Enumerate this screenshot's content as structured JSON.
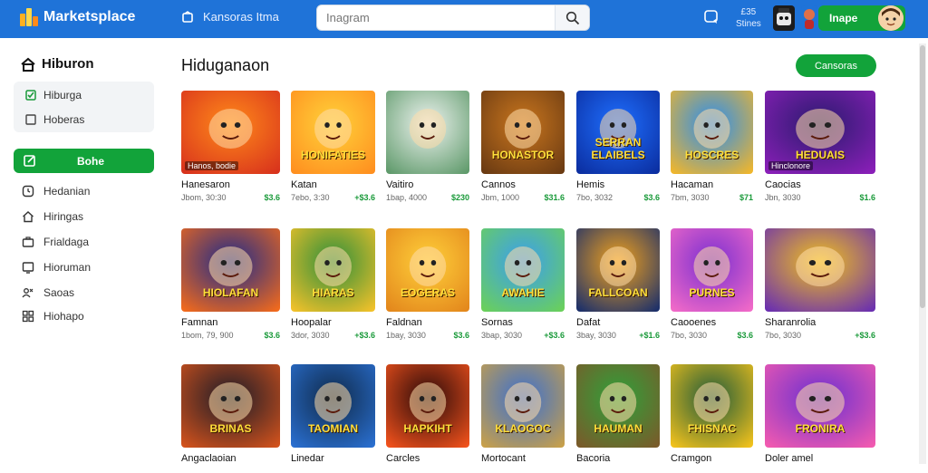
{
  "header": {
    "logo_text": "Marketsplace",
    "nav_label": "Kansoras Itma",
    "search_placeholder": "Inagram",
    "stats_line1": "£35",
    "stats_line2": "Stines",
    "cta_label": "Inape"
  },
  "sidebar": {
    "title": "Hiburon",
    "card_items": [
      {
        "label": "Hiburga",
        "icon": "checkbox-checked-icon"
      },
      {
        "label": "Hoberas",
        "icon": "checkbox-empty-icon"
      }
    ],
    "active_item": {
      "label": "Bohe",
      "icon": "edit-icon"
    },
    "items": [
      {
        "label": "Hedanian",
        "icon": "clock-icon"
      },
      {
        "label": "Hiringas",
        "icon": "home-icon"
      },
      {
        "label": "Frialdaga",
        "icon": "briefcase-icon"
      },
      {
        "label": "Hioruman",
        "icon": "monitor-icon"
      },
      {
        "label": "Saoas",
        "icon": "people-icon"
      },
      {
        "label": "Hiohapo",
        "icon": "grid-icon"
      }
    ]
  },
  "main": {
    "title": "Hiduganaon",
    "cta_label": "Cansoras",
    "rows": [
      [
        {
          "title": "Hanesaron",
          "meta": "Jbom, 30:30",
          "price": "$3.6",
          "art": "",
          "tag": "Hanos, bodie",
          "colors": [
            "#ff8a1a",
            "#d8321c"
          ]
        },
        {
          "title": "Katan",
          "meta": "7ebo, 3:30",
          "price": "+$3.6",
          "art": "HONIFATIES",
          "tag": "",
          "colors": [
            "#ffd23a",
            "#ff8f1f"
          ]
        },
        {
          "title": "Vaitiro",
          "meta": "1bap, 4000",
          "price": "$230",
          "art": "",
          "tag": "",
          "colors": [
            "#eef3f0",
            "#5f9a6b"
          ]
        },
        {
          "title": "Cannos",
          "meta": "Jbm, 1000",
          "price": "$31.6",
          "art": "HONASTOR",
          "tag": "",
          "colors": [
            "#c9761e",
            "#6a3a12"
          ]
        },
        {
          "title": "Hemis",
          "meta": "7bo, 3032",
          "price": "$3.6",
          "art": "SERRAN ELAIBELS",
          "tag": "",
          "colors": [
            "#1f6fff",
            "#0b2ea0"
          ]
        },
        {
          "title": "Hacaman",
          "meta": "7bm, 3030",
          "price": "$71",
          "art": "HOSCRES",
          "tag": "",
          "colors": [
            "#2a8df0",
            "#f0b62c"
          ]
        },
        {
          "title": "Caocias",
          "meta": "Jbn, 3030",
          "price": "$1.6",
          "art": "HEDUAIS",
          "tag": "Hinclonore",
          "colors": [
            "#2a1b6e",
            "#8a1fb8"
          ]
        }
      ],
      [
        {
          "title": "Famnan",
          "meta": "1bom, 79, 900",
          "price": "$3.6",
          "art": "HIOLAFAN",
          "tag": "",
          "colors": [
            "#1d2a8a",
            "#f26a1c"
          ]
        },
        {
          "title": "Hoopalar",
          "meta": "3dor, 3030",
          "price": "+$3.6",
          "art": "HIARAS",
          "tag": "",
          "colors": [
            "#2e8f3a",
            "#f2c12a"
          ]
        },
        {
          "title": "Faldnan",
          "meta": "1bay, 3030",
          "price": "$3.6",
          "art": "EOGERAS",
          "tag": "",
          "colors": [
            "#ffd03a",
            "#e3871c"
          ]
        },
        {
          "title": "Sornas",
          "meta": "3bap, 3030",
          "price": "+$3.6",
          "art": "AWAHIE",
          "tag": "",
          "colors": [
            "#3b9ef0",
            "#6ad05a"
          ]
        },
        {
          "title": "Dafat",
          "meta": "3bay, 3030",
          "price": "+$1.6",
          "art": "FALLCOAN",
          "tag": "",
          "colors": [
            "#f2a21c",
            "#1b2f6a"
          ]
        },
        {
          "title": "Caooenes",
          "meta": "7bo, 3030",
          "price": "$3.6",
          "art": "PURNES",
          "tag": "",
          "colors": [
            "#7a2fd0",
            "#f26ac8"
          ]
        },
        {
          "title": "Sharanrolia",
          "meta": "7bo, 3030",
          "price": "+$3.6",
          "art": "",
          "tag": "",
          "colors": [
            "#f2c21c",
            "#6a2fb0"
          ]
        }
      ],
      [
        {
          "title": "Angaclaoian",
          "meta": "",
          "price": "",
          "art": "BRINAS",
          "tag": "",
          "colors": [
            "#1b1b28",
            "#d2521c"
          ]
        },
        {
          "title": "Linedar",
          "meta": "",
          "price": "",
          "art": "TAOMIAN",
          "tag": "",
          "colors": [
            "#0f2a4a",
            "#2a6fd0"
          ]
        },
        {
          "title": "Carcles",
          "meta": "",
          "price": "",
          "art": "HAPKIHT",
          "tag": "",
          "colors": [
            "#2a0a0a",
            "#f2521c"
          ]
        },
        {
          "title": "Mortocant",
          "meta": "",
          "price": "",
          "art": "KLAOGOC",
          "tag": "",
          "colors": [
            "#3a6fd0",
            "#c8a04a"
          ]
        },
        {
          "title": "Bacoria",
          "meta": "",
          "price": "",
          "art": "HAUMAN",
          "tag": "",
          "colors": [
            "#2fa13a",
            "#7a5a2a"
          ]
        },
        {
          "title": "Cramgon",
          "meta": "",
          "price": "",
          "art": "FHISNAC",
          "tag": "",
          "colors": [
            "#1f5a3a",
            "#f2c21c"
          ]
        },
        {
          "title": "Doler amel",
          "meta": "",
          "price": "",
          "art": "FRONIRA",
          "tag": "",
          "colors": [
            "#6a2fd0",
            "#f25ab0"
          ]
        }
      ]
    ]
  }
}
